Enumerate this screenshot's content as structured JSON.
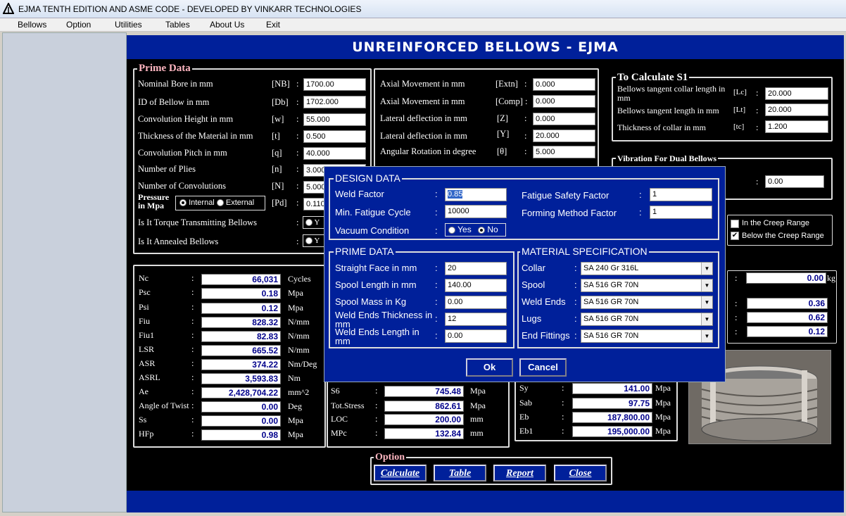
{
  "window": {
    "title": "EJMA TENTH EDITION AND ASME CODE - DEVELOPED BY VINKARR TECHNOLOGIES"
  },
  "menu": [
    "Bellows",
    "Option",
    "Utilities",
    "Tables",
    "About Us",
    "Exit"
  ],
  "header": "UNREINFORCED BELLOWS - EJMA",
  "prime": {
    "title": "Prime Data",
    "rows": [
      {
        "label": "Nominal Bore in mm",
        "sym": "[NB]",
        "value": "1700.00"
      },
      {
        "label": "ID of Bellow in mm",
        "sym": "[Db]",
        "value": "1702.000"
      },
      {
        "label": "Convolution Height in mm",
        "sym": "[w]",
        "value": "55.000"
      },
      {
        "label": "Thickness of the Material in mm",
        "sym": "[t]",
        "value": "0.500"
      },
      {
        "label": "Convolution Pitch in mm",
        "sym": "[q]",
        "value": "40.000"
      },
      {
        "label": "Number of Plies",
        "sym": "[n]",
        "value": "3.000"
      },
      {
        "label": "Number of Convolutions",
        "sym": "[N]",
        "value": "5.000"
      }
    ],
    "pressure_label": "Pressure in Mpa",
    "pressure_internal": "Internal",
    "pressure_external": "External",
    "pressure_sym": "[Pd]",
    "pressure_value": "0.110",
    "torque_label": "Is It Torque Transmitting Bellows",
    "annealed_label": "Is It Annealed Bellows",
    "yes_short": "Y"
  },
  "movement": [
    {
      "label": "Axial Movement in mm",
      "sym": "[Extn]",
      "value": "0.000"
    },
    {
      "label": "Axial Movement in mm",
      "sym": "[Comp]",
      "value": "0.000"
    },
    {
      "label": "Lateral deflection in mm",
      "sym": "[Z]",
      "value": "0.000"
    },
    {
      "label": "Lateral deflection in mm",
      "sym": "[Y]",
      "value": "20.000"
    },
    {
      "label": "Angular Rotation in degree",
      "sym": "[θ]",
      "value": "5.000"
    }
  ],
  "s1": {
    "title": "To Calculate S1",
    "rows": [
      {
        "label": "Bellows tangent collar length in mm",
        "sym": "[Lc]",
        "value": "20.000"
      },
      {
        "label": "Bellows tangent length in mm",
        "sym": "[Lt]",
        "value": "20.000"
      },
      {
        "label": "Thickness of collar in mm",
        "sym": "[tc]",
        "value": "1.200"
      }
    ]
  },
  "vibration": {
    "title": "Vibration For Dual Bellows",
    "value": "0.00"
  },
  "creep": {
    "in_range": "In the Creep Range",
    "below_range": "Below the Creep Range"
  },
  "results_left": [
    {
      "label": "Nc",
      "value": "66,031",
      "unit": "Cycles"
    },
    {
      "label": "Psc",
      "value": "0.18",
      "unit": "Mpa"
    },
    {
      "label": "Psi",
      "value": "0.12",
      "unit": "Mpa"
    },
    {
      "label": "Fiu",
      "value": "828.32",
      "unit": "N/mm"
    },
    {
      "label": "Fiu1",
      "value": "82.83",
      "unit": "N/mm"
    },
    {
      "label": "LSR",
      "value": "665.52",
      "unit": "N/mm"
    },
    {
      "label": "ASR",
      "value": "374.22",
      "unit": "Nm/Deg"
    },
    {
      "label": "ASRL",
      "value": "3,593.83",
      "unit": "Nm"
    },
    {
      "label": "Ae",
      "value": "2,428,704.22",
      "unit": "mm^2"
    },
    {
      "label": "Angle of Twist",
      "value": "0.00",
      "unit": "Deg"
    },
    {
      "label": "Ss",
      "value": "0.00",
      "unit": "Mpa"
    },
    {
      "label": "HFp",
      "value": "0.98",
      "unit": "Mpa"
    }
  ],
  "results_mid": [
    {
      "label": "S6",
      "value": "745.48",
      "unit": "Mpa"
    },
    {
      "label": "Tot.Stress",
      "value": "862.61",
      "unit": "Mpa"
    },
    {
      "label": "LOC",
      "value": "200.00",
      "unit": "mm"
    },
    {
      "label": "MPc",
      "value": "132.84",
      "unit": "mm"
    }
  ],
  "results_right": [
    {
      "label": "Sy",
      "value": "141.00",
      "unit": "Mpa"
    },
    {
      "label": "Sab",
      "value": "97.75",
      "unit": "Mpa"
    },
    {
      "label": "Eb",
      "value": "187,800.00",
      "unit": "Mpa"
    },
    {
      "label": "Eb1",
      "value": "195,000.00",
      "unit": "Mpa"
    }
  ],
  "mass": {
    "value": "0.00",
    "unit": "kg"
  },
  "side_values": [
    "0.36",
    "0.62",
    "0.12"
  ],
  "option": {
    "title": "Option",
    "buttons": [
      "Calculate",
      "Table",
      "Report",
      "Close"
    ]
  },
  "dialog": {
    "design_title": "DESIGN DATA",
    "weld_factor_label": "Weld Factor",
    "weld_factor_value": "0.85",
    "fatigue_safety_label": "Fatigue Safety Factor",
    "fatigue_safety_value": "1",
    "min_fatigue_label": "Min. Fatigue Cycle",
    "min_fatigue_value": "10000",
    "forming_label": "Forming Method Factor",
    "forming_value": "1",
    "vacuum_label": "Vacuum Condition",
    "vacuum_yes": "Yes",
    "vacuum_no": "No",
    "prime_title": "PRIME DATA",
    "prime_rows": [
      {
        "label": "Straight Face in mm",
        "value": "20"
      },
      {
        "label": "Spool Length in mm",
        "value": "140.00"
      },
      {
        "label": "Spool Mass in Kg",
        "value": "0.00"
      },
      {
        "label": "Weld Ends Thickness in mm",
        "value": "12"
      },
      {
        "label": "Weld Ends Length in mm",
        "value": "0.00"
      }
    ],
    "material_title": "MATERIAL SPECIFICATION",
    "material_rows": [
      {
        "label": "Collar",
        "value": "SA 240 Gr 316L"
      },
      {
        "label": "Spool",
        "value": "SA 516 GR 70N"
      },
      {
        "label": "Weld Ends",
        "value": "SA 516 GR 70N"
      },
      {
        "label": "Lugs",
        "value": "SA 516 GR 70N"
      },
      {
        "label": "End Fittings",
        "value": "SA 516 GR 70N"
      }
    ],
    "ok": "Ok",
    "cancel": "Cancel"
  }
}
